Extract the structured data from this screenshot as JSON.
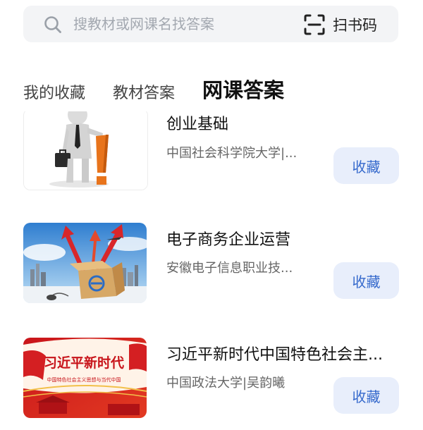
{
  "search": {
    "placeholder": "搜教材或网课名找答案",
    "scan_label": "扫书码"
  },
  "tabs": [
    {
      "label": "我的收藏",
      "active": false
    },
    {
      "label": "教材答案",
      "active": false
    },
    {
      "label": "网课答案",
      "active": true
    }
  ],
  "courses": [
    {
      "title": "创业基础",
      "subtitle": "中国社会科学院大学|...",
      "button": "收藏"
    },
    {
      "title": "电子商务企业运营",
      "subtitle": "安徽电子信息职业技...",
      "button": "收藏"
    },
    {
      "title": "习近平新时代中国特色社会主...",
      "subtitle": "中国政法大学|吴韵曦",
      "button": "收藏",
      "thumb_title": "习近平新时代",
      "thumb_subtitle": "中国特色社会主义思想与当代中国"
    }
  ],
  "colors": {
    "accent": "#3569cc",
    "button_bg": "#e8eefb",
    "search_bg": "#f3f4f6"
  }
}
